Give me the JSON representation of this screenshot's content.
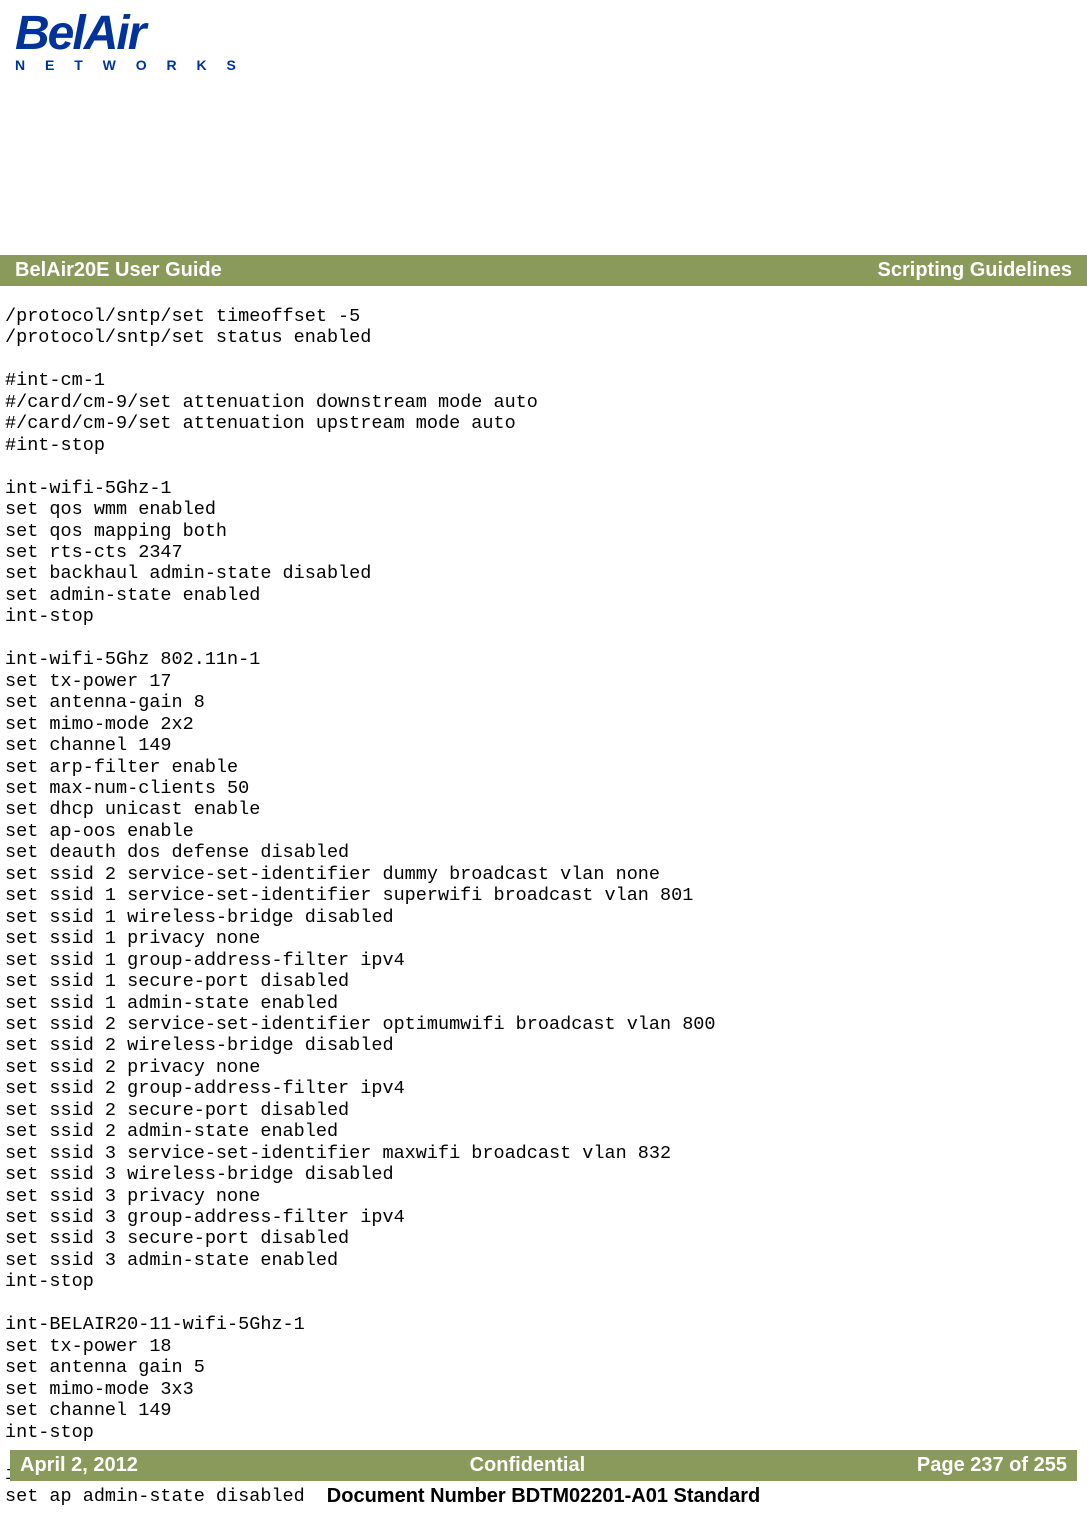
{
  "logo": {
    "main": "BelAir",
    "sub": "N E T W O R K S"
  },
  "titlebar": {
    "left": "BelAir20E User Guide",
    "right": "Scripting Guidelines"
  },
  "script_content": "/protocol/sntp/set timeoffset -5\n/protocol/sntp/set status enabled\n\n#int-cm-1\n#/card/cm-9/set attenuation downstream mode auto\n#/card/cm-9/set attenuation upstream mode auto\n#int-stop\n\nint-wifi-5Ghz-1\nset qos wmm enabled\nset qos mapping both\nset rts-cts 2347\nset backhaul admin-state disabled\nset admin-state enabled\nint-stop\n\nint-wifi-5Ghz 802.11n-1\nset tx-power 17\nset antenna-gain 8\nset mimo-mode 2x2\nset channel 149\nset arp-filter enable\nset max-num-clients 50\nset dhcp unicast enable\nset ap-oos enable\nset deauth dos defense disabled\nset ssid 2 service-set-identifier dummy broadcast vlan none\nset ssid 1 service-set-identifier superwifi broadcast vlan 801\nset ssid 1 wireless-bridge disabled\nset ssid 1 privacy none\nset ssid 1 group-address-filter ipv4\nset ssid 1 secure-port disabled\nset ssid 1 admin-state enabled\nset ssid 2 service-set-identifier optimumwifi broadcast vlan 800\nset ssid 2 wireless-bridge disabled\nset ssid 2 privacy none\nset ssid 2 group-address-filter ipv4\nset ssid 2 secure-port disabled\nset ssid 2 admin-state enabled\nset ssid 3 service-set-identifier maxwifi broadcast vlan 832\nset ssid 3 wireless-bridge disabled\nset ssid 3 privacy none\nset ssid 3 group-address-filter ipv4\nset ssid 3 secure-port disabled\nset ssid 3 admin-state enabled\nint-stop\n\nint-BELAIR20-11-wifi-5Ghz-1\nset tx-power 18\nset antenna gain 5\nset mimo-mode 3x3\nset channel 149\nint-stop\n\nint-wifi-5Ghz 802.11a-1\nset ap admin-state disabled",
  "footer": {
    "left": "April 2, 2012",
    "center": "Confidential",
    "right": "Page 237 of 255"
  },
  "doc_number": "Document Number BDTM02201-A01 Standard"
}
